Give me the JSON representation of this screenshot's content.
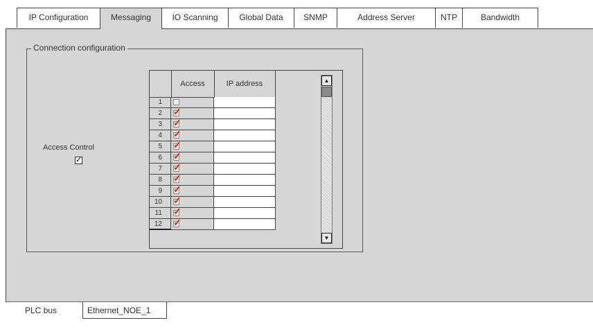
{
  "top_tabs": [
    {
      "label": "IP Configuration",
      "active": false
    },
    {
      "label": "Messaging",
      "active": true
    },
    {
      "label": "IO Scanning",
      "active": false
    },
    {
      "label": "Global Data",
      "active": false
    },
    {
      "label": "SNMP",
      "active": false
    },
    {
      "label": "Address Server",
      "active": false
    },
    {
      "label": "NTP",
      "active": false
    },
    {
      "label": "Bandwidth",
      "active": false
    }
  ],
  "group": {
    "title": "Connection configuration"
  },
  "access_control": {
    "label": "Access Control",
    "checked": true,
    "mark": "✓"
  },
  "table": {
    "headers": {
      "access": "Access",
      "ip": "IP address"
    },
    "rows": [
      {
        "num": "1",
        "access": false,
        "ip": ""
      },
      {
        "num": "2",
        "access": true,
        "ip": ""
      },
      {
        "num": "3",
        "access": true,
        "ip": ""
      },
      {
        "num": "4",
        "access": true,
        "ip": ""
      },
      {
        "num": "5",
        "access": true,
        "ip": ""
      },
      {
        "num": "6",
        "access": true,
        "ip": ""
      },
      {
        "num": "7",
        "access": true,
        "ip": ""
      },
      {
        "num": "8",
        "access": true,
        "ip": ""
      },
      {
        "num": "9",
        "access": true,
        "ip": ""
      },
      {
        "num": "10",
        "access": true,
        "ip": ""
      },
      {
        "num": "11",
        "access": true,
        "ip": ""
      },
      {
        "num": "12",
        "access": true,
        "ip": ""
      }
    ],
    "check_mark": "✓",
    "check_color": "#d42020"
  },
  "scrollbar": {
    "up_icon": "scroll-up-arrow-icon",
    "down_icon": "scroll-down-arrow-icon",
    "up_glyph": "▲",
    "down_glyph": "▼"
  },
  "bottom_tabs": [
    {
      "label": "PLC bus",
      "active": false
    },
    {
      "label": "Ethernet_NOE_1",
      "active": true
    }
  ]
}
